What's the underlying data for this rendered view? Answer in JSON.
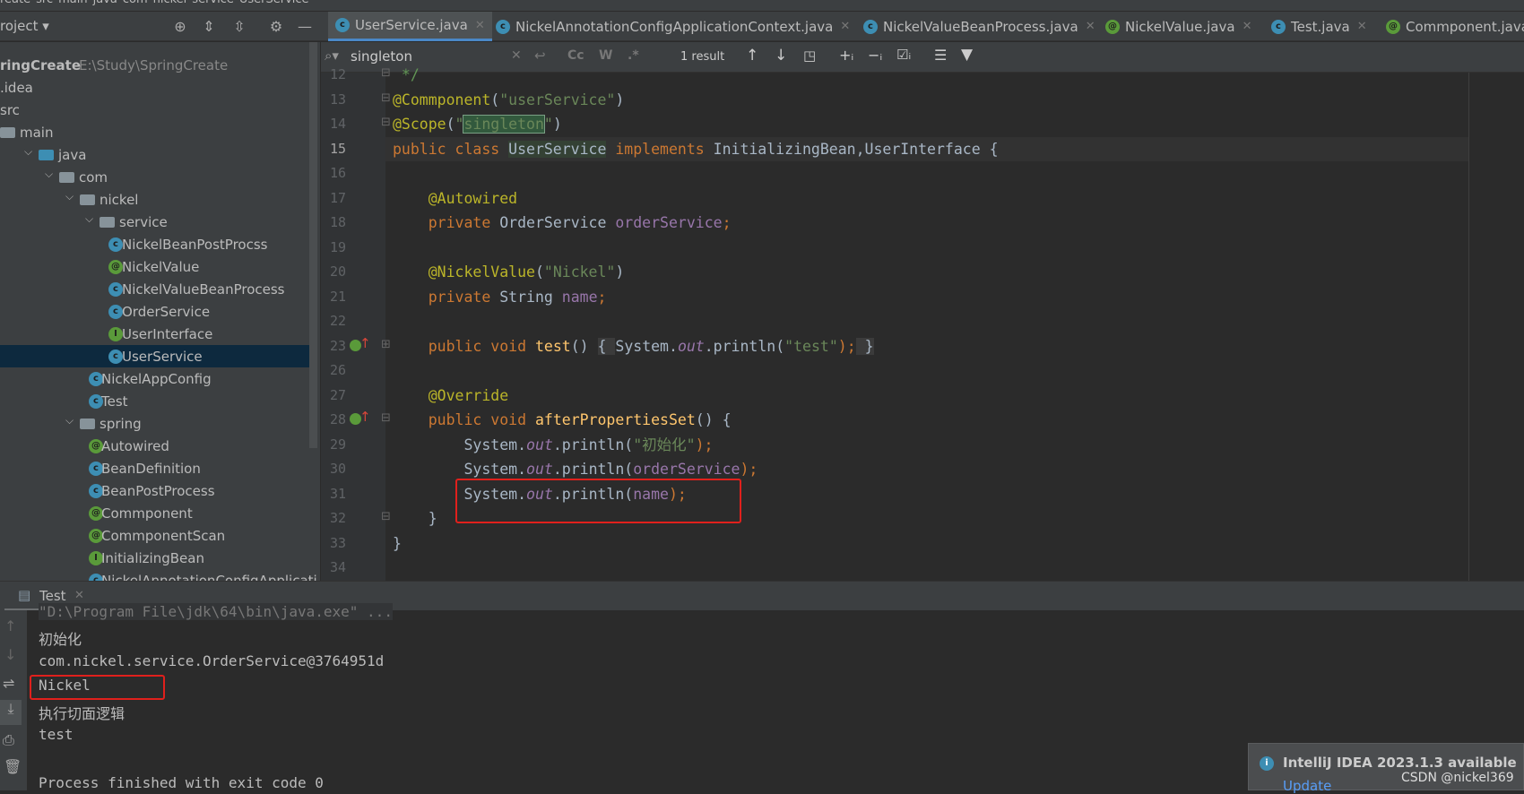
{
  "breadcrumb": [
    "reate",
    "src",
    "main",
    "java",
    "com",
    "nickel",
    "service",
    "UserService"
  ],
  "toolbar": {
    "project_label": "roject ▾",
    "run_config": "Test"
  },
  "tabs": [
    {
      "label": "UserService.java",
      "icon": "c",
      "active": true
    },
    {
      "label": "NickelAnnotationConfigApplicationContext.java",
      "icon": "c"
    },
    {
      "label": "NickelValueBeanProcess.java",
      "icon": "c"
    },
    {
      "label": "NickelValue.java",
      "icon": "a"
    },
    {
      "label": "Test.java",
      "icon": "c"
    },
    {
      "label": "Commponent.java",
      "icon": "a"
    }
  ],
  "project": {
    "root": {
      "name": "ringCreate",
      "path": "E:\\Study\\SpringCreate"
    },
    "items": [
      {
        "label": ".idea",
        "depth": -1
      },
      {
        "label": "src",
        "depth": -1
      },
      {
        "label": "main",
        "type": "folder",
        "depth": 0
      },
      {
        "label": "java",
        "type": "folder-blue",
        "depth": 1,
        "open": true
      },
      {
        "label": "com",
        "type": "package",
        "depth": 2,
        "open": true
      },
      {
        "label": "nickel",
        "type": "package",
        "depth": 3,
        "open": true
      },
      {
        "label": "service",
        "type": "package",
        "depth": 4,
        "open": true
      },
      {
        "label": "NickelBeanPostProcss",
        "type": "c",
        "depth": 5
      },
      {
        "label": "NickelValue",
        "type": "a",
        "depth": 5
      },
      {
        "label": "NickelValueBeanProcess",
        "type": "c",
        "depth": 5
      },
      {
        "label": "OrderService",
        "type": "c",
        "depth": 5
      },
      {
        "label": "UserInterface",
        "type": "i",
        "depth": 5
      },
      {
        "label": "UserService",
        "type": "c",
        "depth": 5,
        "selected": true
      },
      {
        "label": "NickelAppConfig",
        "type": "c",
        "depth": 4
      },
      {
        "label": "Test",
        "type": "c",
        "depth": 4
      },
      {
        "label": "spring",
        "type": "package",
        "depth": 3,
        "open": true
      },
      {
        "label": "Autowired",
        "type": "a",
        "depth": 4
      },
      {
        "label": "BeanDefinition",
        "type": "c",
        "depth": 4
      },
      {
        "label": "BeanPostProcess",
        "type": "c",
        "depth": 4
      },
      {
        "label": "Commponent",
        "type": "a",
        "depth": 4
      },
      {
        "label": "CommponentScan",
        "type": "a",
        "depth": 4
      },
      {
        "label": "InitializingBean",
        "type": "i",
        "depth": 4
      },
      {
        "label": "NickelAnnotationConfigApplicati",
        "type": "c",
        "depth": 4
      }
    ]
  },
  "search": {
    "query": "singleton",
    "result_count": "1 result",
    "options": [
      "Cc",
      "W",
      ".*"
    ]
  },
  "editor": {
    "current_line": "15",
    "lines": [
      {
        "n": "12",
        "t": [
          [
            " */",
            "cm"
          ]
        ]
      },
      {
        "n": "13",
        "t": [
          [
            "@Commponent",
            "an"
          ],
          [
            "(",
            "tx"
          ],
          [
            "\"userService\"",
            "st"
          ],
          [
            ")",
            "tx"
          ]
        ]
      },
      {
        "n": "14",
        "t": [
          [
            "@Scope",
            "an"
          ],
          [
            "(",
            "tx"
          ],
          [
            "\"",
            "st"
          ],
          [
            "singleton",
            "st sg"
          ],
          [
            "\"",
            "st"
          ],
          [
            ")",
            "tx"
          ]
        ]
      },
      {
        "n": "15",
        "t": [
          [
            "public class ",
            "kw"
          ],
          [
            "UserService",
            "tx hl"
          ],
          [
            " implements ",
            "kw"
          ],
          [
            "InitializingBean,UserInterface {",
            "tx"
          ]
        ]
      },
      {
        "n": "16",
        "t": []
      },
      {
        "n": "17",
        "t": [
          [
            "    @Autowired",
            "an"
          ]
        ]
      },
      {
        "n": "18",
        "t": [
          [
            "    private ",
            "kw"
          ],
          [
            "OrderService ",
            "tx"
          ],
          [
            "orderService",
            "fd"
          ],
          [
            ";",
            "kw"
          ]
        ]
      },
      {
        "n": "19",
        "t": []
      },
      {
        "n": "20",
        "t": [
          [
            "    @NickelValue",
            "an"
          ],
          [
            "(",
            "tx"
          ],
          [
            "\"Nickel\"",
            "st"
          ],
          [
            ")",
            "tx"
          ]
        ]
      },
      {
        "n": "21",
        "t": [
          [
            "    private ",
            "kw"
          ],
          [
            "String ",
            "tx"
          ],
          [
            "name",
            "fd"
          ],
          [
            ";",
            "kw"
          ]
        ]
      },
      {
        "n": "22",
        "t": []
      },
      {
        "n": "23",
        "t": [
          [
            "    public void ",
            "kw"
          ],
          [
            "test",
            "fn"
          ],
          [
            "() ",
            "tx"
          ],
          [
            "{ ",
            "tx fold"
          ],
          [
            "System.",
            "tx"
          ],
          [
            "out",
            "it"
          ],
          [
            ".println(",
            "tx"
          ],
          [
            "\"test\"",
            "st"
          ],
          [
            ");",
            "kw"
          ],
          [
            " }",
            "tx fold"
          ]
        ]
      },
      {
        "n": "26",
        "t": []
      },
      {
        "n": "27",
        "t": [
          [
            "    @Override",
            "an"
          ]
        ]
      },
      {
        "n": "28",
        "t": [
          [
            "    public void ",
            "kw"
          ],
          [
            "afterPropertiesSet",
            "fn"
          ],
          [
            "() {",
            "tx"
          ]
        ]
      },
      {
        "n": "29",
        "t": [
          [
            "        System.",
            "tx"
          ],
          [
            "out",
            "it"
          ],
          [
            ".println(",
            "tx"
          ],
          [
            "\"初始化\"",
            "st"
          ],
          [
            ");",
            "kw"
          ]
        ]
      },
      {
        "n": "30",
        "t": [
          [
            "        System.",
            "tx"
          ],
          [
            "out",
            "it"
          ],
          [
            ".println(",
            "tx"
          ],
          [
            "orderService",
            "fd"
          ],
          [
            ");",
            "kw"
          ]
        ]
      },
      {
        "n": "31",
        "t": [
          [
            "        System.",
            "tx"
          ],
          [
            "out",
            "it"
          ],
          [
            ".println(",
            "tx"
          ],
          [
            "name",
            "fd"
          ],
          [
            ");",
            "kw"
          ]
        ]
      },
      {
        "n": "32",
        "t": [
          [
            "    }",
            "tx"
          ]
        ]
      },
      {
        "n": "33",
        "t": [
          [
            "}",
            "tx"
          ]
        ]
      },
      {
        "n": "34",
        "t": []
      }
    ]
  },
  "run_panel": {
    "tab_label": "Test",
    "output": [
      "\"D:\\Program File\\jdk\\64\\bin\\java.exe\" ...",
      "初始化",
      "com.nickel.service.OrderService@3764951d",
      "Nickel",
      "执行切面逻辑",
      "test",
      "",
      "Process finished with exit code 0"
    ]
  },
  "notification": {
    "title": "IntelliJ IDEA 2023.1.3 available",
    "action": "Update"
  },
  "watermark": "CSDN @nickel369",
  "colors": {
    "accent": "#4a88c7",
    "highlight_box": "#e0201c",
    "selection": "#0d293e"
  }
}
